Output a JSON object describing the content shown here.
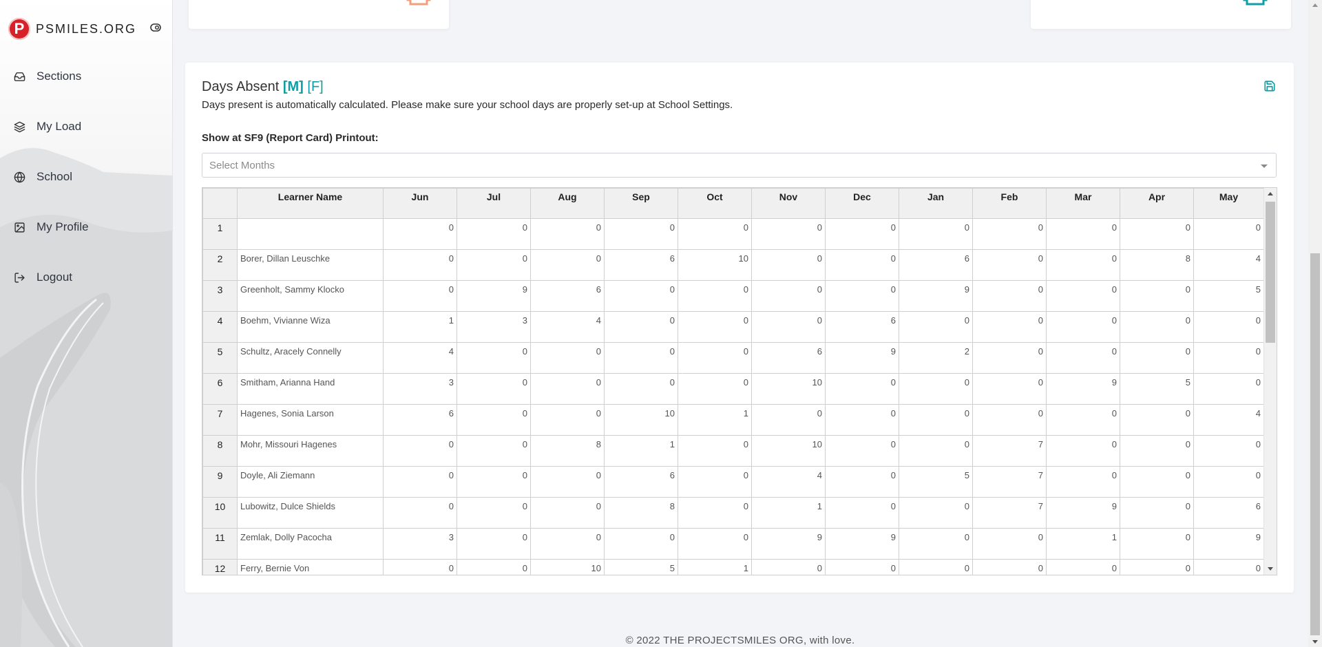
{
  "brand": {
    "logo_letter": "P",
    "name": "PSMILES.ORG"
  },
  "sidebar": {
    "items": [
      {
        "label": "Sections",
        "icon": "inbox-icon"
      },
      {
        "label": "My Load",
        "icon": "layers-icon"
      },
      {
        "label": "School",
        "icon": "globe-icon"
      },
      {
        "label": "My Profile",
        "icon": "image-icon"
      },
      {
        "label": "Logout",
        "icon": "logout-icon"
      }
    ]
  },
  "colors": {
    "accent": "#0f9ea4",
    "brand_red": "#d8202a",
    "orange": "#f2a07b"
  },
  "card": {
    "title": "Days Absent",
    "tag_m": "[M]",
    "tag_f": "[F]",
    "description": "Days present is automatically calculated. Please make sure your school days are properly set-up at School Settings.",
    "show_label": "Show at SF9 (Report Card) Printout:",
    "select_placeholder": "Select Months"
  },
  "table": {
    "columns": [
      "Learner Name",
      "Jun",
      "Jul",
      "Aug",
      "Sep",
      "Oct",
      "Nov",
      "Dec",
      "Jan",
      "Feb",
      "Mar",
      "Apr",
      "May"
    ],
    "rows": [
      {
        "num": "1",
        "name": "",
        "values": [
          "0",
          "0",
          "0",
          "0",
          "0",
          "0",
          "0",
          "0",
          "0",
          "0",
          "0",
          "0"
        ]
      },
      {
        "num": "2",
        "name": "Borer, Dillan Leuschke",
        "values": [
          "0",
          "0",
          "0",
          "6",
          "10",
          "0",
          "0",
          "6",
          "0",
          "0",
          "8",
          "4"
        ]
      },
      {
        "num": "3",
        "name": "Greenholt, Sammy Klocko",
        "values": [
          "0",
          "9",
          "6",
          "0",
          "0",
          "0",
          "0",
          "9",
          "0",
          "0",
          "0",
          "5"
        ]
      },
      {
        "num": "4",
        "name": "Boehm, Vivianne Wiza",
        "values": [
          "1",
          "3",
          "4",
          "0",
          "0",
          "0",
          "6",
          "0",
          "0",
          "0",
          "0",
          "0"
        ]
      },
      {
        "num": "5",
        "name": "Schultz, Aracely Connelly",
        "values": [
          "4",
          "0",
          "0",
          "0",
          "0",
          "6",
          "9",
          "2",
          "0",
          "0",
          "0",
          "0"
        ]
      },
      {
        "num": "6",
        "name": "Smitham, Arianna Hand",
        "values": [
          "3",
          "0",
          "0",
          "0",
          "0",
          "10",
          "0",
          "0",
          "0",
          "9",
          "5",
          "0"
        ]
      },
      {
        "num": "7",
        "name": "Hagenes, Sonia Larson",
        "values": [
          "6",
          "0",
          "0",
          "10",
          "1",
          "0",
          "0",
          "0",
          "0",
          "0",
          "0",
          "4"
        ]
      },
      {
        "num": "8",
        "name": "Mohr, Missouri Hagenes",
        "values": [
          "0",
          "0",
          "8",
          "1",
          "0",
          "10",
          "0",
          "0",
          "7",
          "0",
          "0",
          "0"
        ]
      },
      {
        "num": "9",
        "name": "Doyle, Ali Ziemann",
        "values": [
          "0",
          "0",
          "0",
          "6",
          "0",
          "4",
          "0",
          "5",
          "7",
          "0",
          "0",
          "0"
        ]
      },
      {
        "num": "10",
        "name": "Lubowitz, Dulce Shields",
        "values": [
          "0",
          "0",
          "0",
          "8",
          "0",
          "1",
          "0",
          "0",
          "7",
          "9",
          "0",
          "6"
        ]
      },
      {
        "num": "11",
        "name": "Zemlak, Dolly Pacocha",
        "values": [
          "3",
          "0",
          "0",
          "0",
          "0",
          "9",
          "9",
          "0",
          "0",
          "1",
          "0",
          "9"
        ]
      },
      {
        "num": "12",
        "name": "Ferry, Bernie Von",
        "values": [
          "0",
          "0",
          "10",
          "5",
          "1",
          "0",
          "0",
          "0",
          "0",
          "0",
          "0",
          "0"
        ]
      }
    ]
  },
  "footer": "© 2022 THE PROJECTSMILES ORG, with love."
}
